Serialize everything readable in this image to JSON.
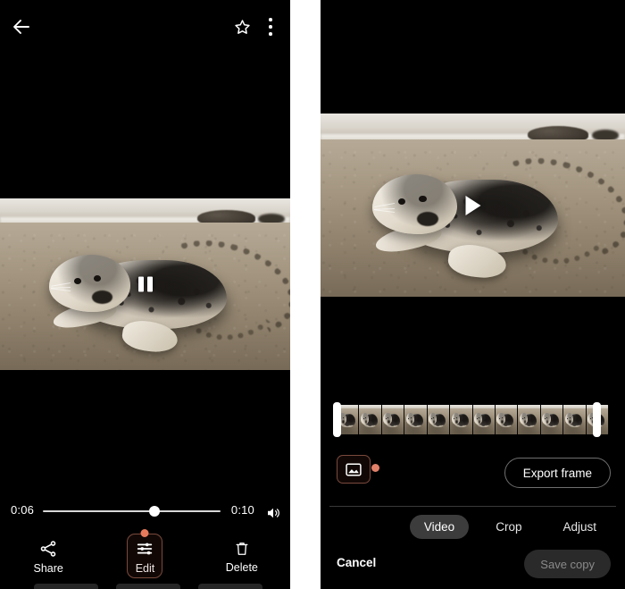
{
  "left_panel": {
    "topbar": {
      "back_icon": "back-arrow-icon",
      "favorite_icon": "star-outline-icon",
      "overflow_icon": "more-vert-icon"
    },
    "player": {
      "state_icon": "pause-icon",
      "current_time": "0:06",
      "total_time": "0:10",
      "progress_percent": 63,
      "volume_icon": "volume-up-icon"
    },
    "actions": [
      {
        "label": "Share",
        "icon": "share-icon",
        "highlighted": false,
        "badge": false
      },
      {
        "label": "Edit",
        "icon": "tune-sliders-icon",
        "highlighted": true,
        "badge": true
      },
      {
        "label": "Delete",
        "icon": "trash-icon",
        "highlighted": false,
        "badge": false
      }
    ]
  },
  "right_panel": {
    "player": {
      "state_icon": "play-icon"
    },
    "timeline": {
      "frame_count": 12,
      "left_handle": "trim-handle-left",
      "right_handle": "trim-handle-right"
    },
    "export_row": {
      "frame_icon": "export-frame-icon",
      "badge": true,
      "button_label": "Export frame"
    },
    "tabs": [
      {
        "label": "Video",
        "selected": true
      },
      {
        "label": "Crop",
        "selected": false
      },
      {
        "label": "Adjust",
        "selected": false
      }
    ],
    "footer": {
      "cancel_label": "Cancel",
      "save_label": "Save copy",
      "save_enabled": false
    }
  },
  "colors": {
    "background": "#000000",
    "gap": "#ffffff",
    "accent_badge": "#e87a5c",
    "highlight_border": "#7a4a3c",
    "tab_selected_bg": "#3c3c3c",
    "save_disabled_text": "#8a8a8a"
  }
}
